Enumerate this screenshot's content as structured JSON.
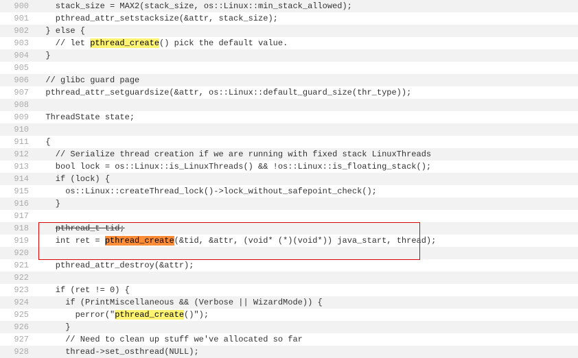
{
  "lines": [
    {
      "ln": "900",
      "segs": [
        {
          "t": "    stack_size = MAX2(stack_size, os::Linux::min_stack_allowed);"
        }
      ]
    },
    {
      "ln": "901",
      "segs": [
        {
          "t": "    pthread_attr_setstacksize(&attr, stack_size);"
        }
      ]
    },
    {
      "ln": "902",
      "segs": [
        {
          "t": "  } else {"
        }
      ]
    },
    {
      "ln": "903",
      "segs": [
        {
          "t": "    // let "
        },
        {
          "t": "pthread_create",
          "hl": "yellow"
        },
        {
          "t": "() pick the default value."
        }
      ]
    },
    {
      "ln": "904",
      "segs": [
        {
          "t": "  }"
        }
      ]
    },
    {
      "ln": "905",
      "segs": [
        {
          "t": ""
        }
      ]
    },
    {
      "ln": "906",
      "segs": [
        {
          "t": "  // glibc guard page"
        }
      ]
    },
    {
      "ln": "907",
      "segs": [
        {
          "t": "  pthread_attr_setguardsize(&attr, os::Linux::default_guard_size(thr_type));"
        }
      ]
    },
    {
      "ln": "908",
      "segs": [
        {
          "t": ""
        }
      ]
    },
    {
      "ln": "909",
      "segs": [
        {
          "t": "  ThreadState state;"
        }
      ]
    },
    {
      "ln": "910",
      "segs": [
        {
          "t": ""
        }
      ]
    },
    {
      "ln": "911",
      "segs": [
        {
          "t": "  {"
        }
      ]
    },
    {
      "ln": "912",
      "segs": [
        {
          "t": "    // Serialize thread creation if we are running with fixed stack LinuxThreads"
        }
      ]
    },
    {
      "ln": "913",
      "segs": [
        {
          "t": "    bool lock = os::Linux::is_LinuxThreads() && !os::Linux::is_floating_stack();"
        }
      ]
    },
    {
      "ln": "914",
      "segs": [
        {
          "t": "    if (lock) {"
        }
      ]
    },
    {
      "ln": "915",
      "segs": [
        {
          "t": "      os::Linux::createThread_lock()->lock_without_safepoint_check();"
        }
      ]
    },
    {
      "ln": "916",
      "segs": [
        {
          "t": "    }"
        }
      ]
    },
    {
      "ln": "917",
      "segs": [
        {
          "t": ""
        }
      ]
    },
    {
      "ln": "918",
      "segs": [
        {
          "t": "    ",
          "strike": false
        },
        {
          "t": "pthread_t tid;",
          "strike": true
        }
      ]
    },
    {
      "ln": "919",
      "segs": [
        {
          "t": "    int ret = "
        },
        {
          "t": "pthread_create",
          "hl": "orange"
        },
        {
          "t": "(&tid, &attr, (void* (*)(void*)) java_start, thread);"
        }
      ]
    },
    {
      "ln": "920",
      "segs": [
        {
          "t": ""
        }
      ]
    },
    {
      "ln": "921",
      "segs": [
        {
          "t": "    pthread_attr_destroy(&attr);"
        }
      ]
    },
    {
      "ln": "922",
      "segs": [
        {
          "t": ""
        }
      ]
    },
    {
      "ln": "923",
      "segs": [
        {
          "t": "    if (ret != 0) {"
        }
      ]
    },
    {
      "ln": "924",
      "segs": [
        {
          "t": "      if (PrintMiscellaneous && (Verbose || WizardMode)) {"
        }
      ]
    },
    {
      "ln": "925",
      "segs": [
        {
          "t": "        perror(\""
        },
        {
          "t": "pthread_create",
          "hl": "yellow"
        },
        {
          "t": "()\");"
        }
      ]
    },
    {
      "ln": "926",
      "segs": [
        {
          "t": "      }"
        }
      ]
    },
    {
      "ln": "927",
      "segs": [
        {
          "t": "      // Need to clean up stuff we've allocated so far"
        }
      ]
    },
    {
      "ln": "928",
      "segs": [
        {
          "t": "      thread->set_osthread(NULL);"
        }
      ]
    }
  ]
}
